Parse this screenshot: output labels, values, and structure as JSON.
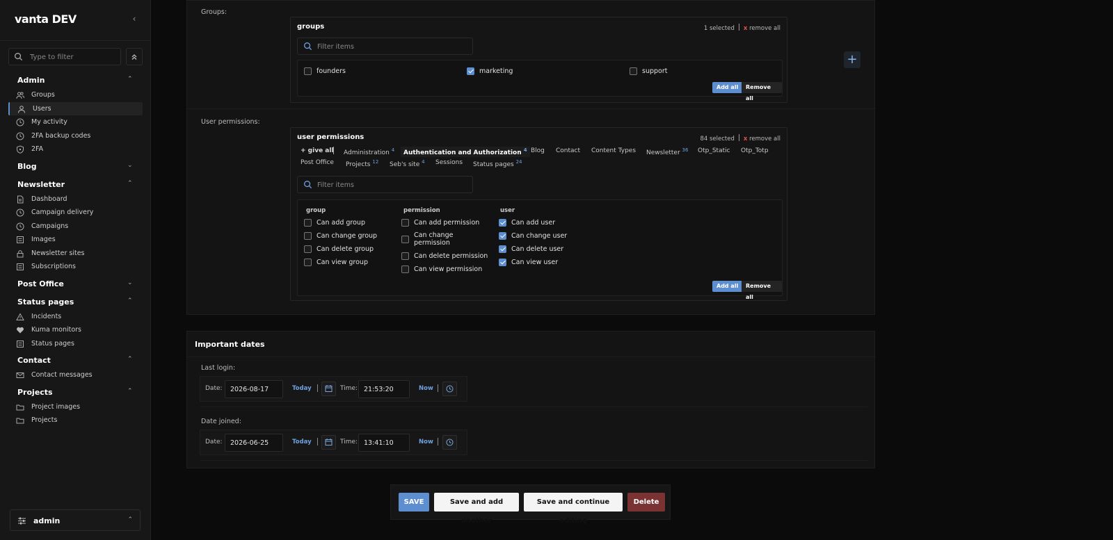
{
  "sidebar": {
    "brand": "vanta DEV",
    "filter_placeholder": "Type to filter",
    "sections": [
      {
        "label": "Admin",
        "items": [
          "Groups",
          "Users",
          "My activity",
          "2FA backup codes",
          "2FA"
        ]
      },
      {
        "label": "Blog",
        "items": []
      },
      {
        "label": "Newsletter",
        "items": [
          "Dashboard",
          "Campaign delivery",
          "Campaigns",
          "Images",
          "Newsletter sites",
          "Subscriptions"
        ]
      },
      {
        "label": "Post Office",
        "items": []
      },
      {
        "label": "Status pages",
        "items": [
          "Incidents",
          "Kuma monitors",
          "Status pages"
        ]
      },
      {
        "label": "Contact",
        "items": [
          "Contact messages"
        ]
      },
      {
        "label": "Projects",
        "items": [
          "Project images",
          "Projects"
        ]
      }
    ],
    "user": "admin"
  },
  "groups": {
    "row_label": "Groups:",
    "title": "groups",
    "count": "1 selected",
    "remove_all_x": "x",
    "remove_all": "remove all",
    "filter_placeholder": "Filter items",
    "options": [
      {
        "label": "founders",
        "checked": false
      },
      {
        "label": "marketing",
        "checked": true
      },
      {
        "label": "support",
        "checked": false
      }
    ],
    "add_all": "Add all",
    "remove_all_btn": "Remove all",
    "add_icon": "plus-icon"
  },
  "permissions": {
    "row_label": "User permissions:",
    "title": "user permissions",
    "count": "84 selected",
    "remove_all_x": "x",
    "remove_all": "remove all",
    "give_all": "+ give all",
    "tabs": [
      {
        "label": "Administration",
        "count": "4"
      },
      {
        "label": "Authentication and Authorization",
        "count": "4"
      },
      {
        "label": "Blog",
        "count": ""
      },
      {
        "label": "Contact",
        "count": ""
      },
      {
        "label": "Content Types",
        "count": ""
      },
      {
        "label": "Newsletter",
        "count": "36"
      },
      {
        "label": "Otp_Static",
        "count": ""
      },
      {
        "label": "Otp_Totp",
        "count": ""
      },
      {
        "label": "Post Office",
        "count": ""
      },
      {
        "label": "Projects",
        "count": "12"
      },
      {
        "label": "Seb's site",
        "count": "4"
      },
      {
        "label": "Sessions",
        "count": ""
      },
      {
        "label": "Status pages",
        "count": "24"
      }
    ],
    "filter_placeholder": "Filter items",
    "columns": [
      {
        "header": "group",
        "items": [
          {
            "label": "Can add group",
            "checked": false
          },
          {
            "label": "Can change group",
            "checked": false
          },
          {
            "label": "Can delete group",
            "checked": false
          },
          {
            "label": "Can view group",
            "checked": false
          }
        ]
      },
      {
        "header": "permission",
        "items": [
          {
            "label": "Can add permission",
            "checked": false
          },
          {
            "label": "Can change permission",
            "line1": "Can change",
            "line2": "permission",
            "checked": false
          },
          {
            "label": "Can delete permission",
            "checked": false
          },
          {
            "label": "Can view permission",
            "checked": false
          }
        ]
      },
      {
        "header": "user",
        "items": [
          {
            "label": "Can add user",
            "checked": true
          },
          {
            "label": "Can change user",
            "checked": true
          },
          {
            "label": "Can delete user",
            "checked": true
          },
          {
            "label": "Can view user",
            "checked": true
          }
        ]
      }
    ],
    "add_all": "Add all",
    "remove_all_btn": "Remove all"
  },
  "dates": {
    "title": "Important dates",
    "last_login": {
      "label": "Last login:",
      "date_label": "Date:",
      "date": "2026-08-17",
      "today": "Today",
      "time_label": "Time:",
      "time": "21:53:20",
      "now": "Now"
    },
    "date_joined": {
      "label": "Date joined:",
      "date_label": "Date:",
      "date": "2026-06-25",
      "today": "Today",
      "time_label": "Time:",
      "time": "13:41:10",
      "now": "Now"
    }
  },
  "actions": {
    "save": "SAVE",
    "save_add": "Save and add another",
    "save_continue": "Save and continue editing",
    "delete": "Delete"
  },
  "colors": {
    "accent": "#5d8fd0",
    "danger": "#7a3232",
    "background": "#0b0b0b"
  }
}
